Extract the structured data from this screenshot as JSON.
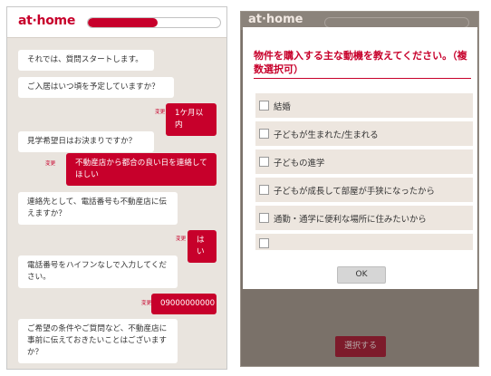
{
  "left": {
    "logo": "at·home",
    "progress": 0.53,
    "messages": [
      {
        "type": "in",
        "text": "それでは、質問スタートします。"
      },
      {
        "type": "in",
        "text": "ご入居はいつ頃を予定していますか？"
      },
      {
        "type": "out",
        "text": "1ケ月以内",
        "change": "変更"
      },
      {
        "type": "in",
        "text": "見学希望日はお決まりですか？"
      },
      {
        "type": "out",
        "text": "不動産店から都合の良い日を連絡してほしい",
        "change": "変更"
      },
      {
        "type": "in",
        "text": "連絡先として、電話番号も不動産店に伝えますか？"
      },
      {
        "type": "out",
        "text": "はい",
        "change": "変更"
      },
      {
        "type": "in",
        "text": "電話番号をハイフンなしで入力してください。"
      },
      {
        "type": "out",
        "text": "09000000000",
        "change": "変更"
      },
      {
        "type": "in",
        "text": "ご希望の条件やご質問など、不動産店に事前に伝えておきたいことはございますか？"
      }
    ]
  },
  "right": {
    "logo": "at·home",
    "modal": {
      "title": "物件を購入する主な動機を教えてください。（複数選択可）",
      "options": [
        "結婚",
        "子どもが生まれた/生まれる",
        "子どもの進学",
        "子どもが成長して部屋が手狭になったから",
        "通勤・通学に便利な場所に住みたいから"
      ],
      "ok_label": "OK"
    },
    "select_label": "選択する"
  },
  "colors": {
    "accent": "#c7002b",
    "chat_bg": "#e9e4de"
  }
}
